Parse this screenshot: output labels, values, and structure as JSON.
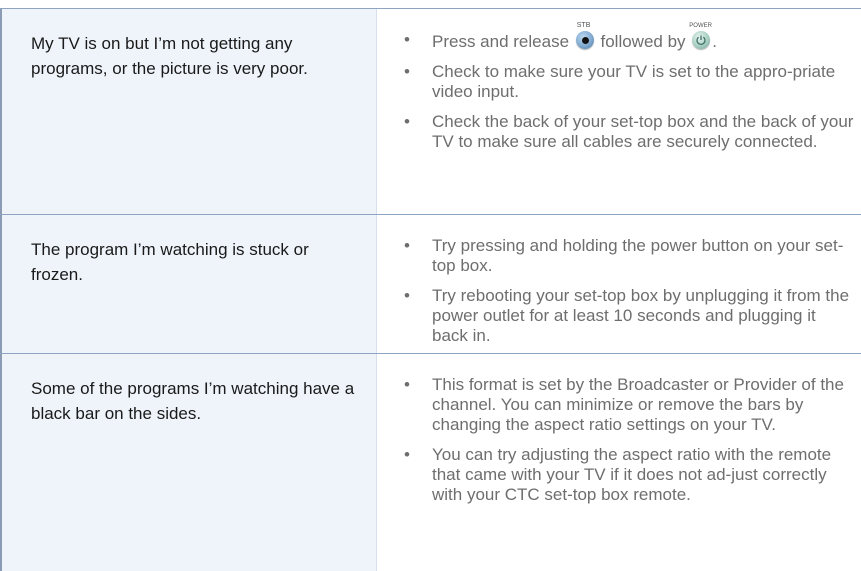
{
  "rows": [
    {
      "question": "My TV is on but I’m not getting any programs, or the picture is very poor.",
      "answers": [
        {
          "prefix": "Press and release",
          "button1_label": "STB",
          "middle": "followed by",
          "button2_label": "POWER",
          "suffix": "."
        },
        "Check to make sure your TV is set to the appro-priate video input.",
        "Check the back of your set-top box and the back of your TV to make sure all cables are securely connected."
      ]
    },
    {
      "question": "The program I’m watching is stuck or frozen.",
      "answers": [
        "Try pressing and holding the power button on your set-top box.",
        "Try rebooting your set-top box by unplugging it  from the power outlet for at least 10 seconds and plugging it back in."
      ]
    },
    {
      "question": "Some of the programs I’m watching have a black bar on the sides.",
      "answers": [
        "This format is set by the Broadcaster or Provider of the channel. You can minimize or remove the bars by changing the aspect ratio settings on your TV.",
        "You can try adjusting the aspect ratio with the remote that came with your TV if it does not ad-just correctly with your CTC set-top box remote."
      ]
    }
  ],
  "icons": {
    "stb_button": "stb-button-icon",
    "power_button": "power-button-icon"
  },
  "colors": {
    "left_cell_bg": "#eef4fa",
    "divider": "#8fa4c2",
    "answer_text": "#6e6e6e",
    "question_text": "#1a1a1a"
  }
}
